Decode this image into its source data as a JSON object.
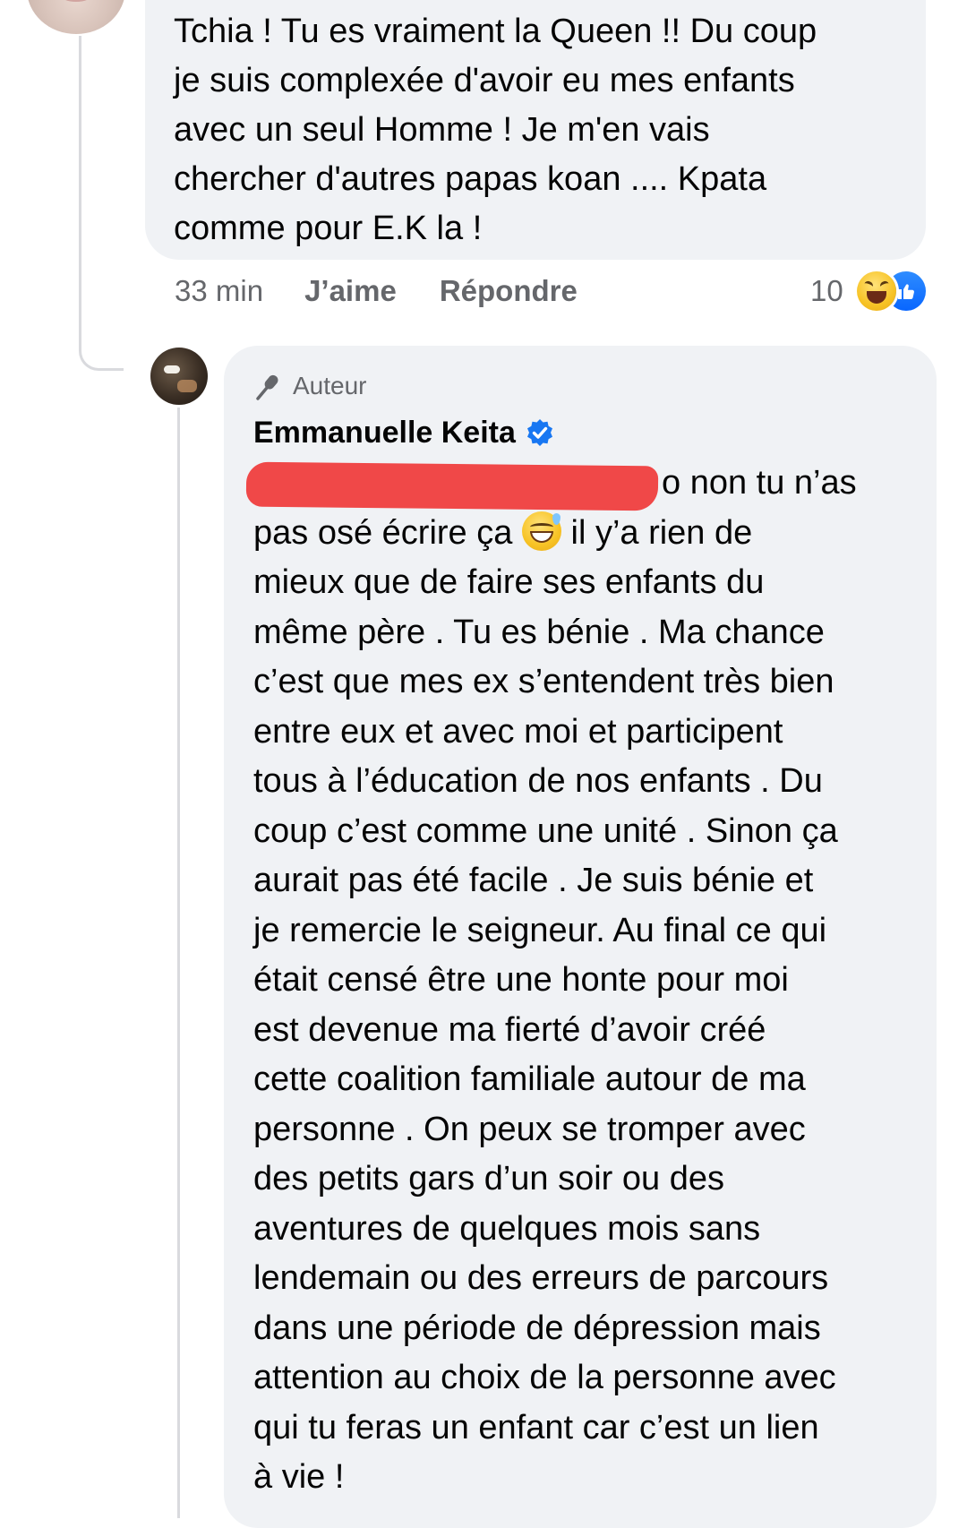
{
  "first_comment": {
    "text": "Tchia ! Tu es vraiment la Queen !! Du  coup\nje suis complexée d'avoir eu mes enfants\navec un seul Homme  ! Je m'en  vais\nchercher d'autres papas koan .... Kpata\ncomme pour E.K la !",
    "time": "33 min",
    "like_label": "J’aime",
    "reply_label": "Répondre",
    "reaction_count": "10",
    "reactions": [
      "haha-icon",
      "like-icon"
    ]
  },
  "reply": {
    "badge_label": "Auteur",
    "author_name": "Emmanuelle Keita",
    "verified": true,
    "text_lines": [
      "o  non tu n’as",
      "pas osé écrire ça",
      "il y’a rien de",
      "mieux que de faire ses enfants du\nmême père . Tu es bénie . Ma chance\nc’est que mes ex s’entendent très bien\nentre eux et avec moi et participent\ntous à l’éducation de nos enfants . Du\ncoup c’est comme une unité . Sinon ça\naurait pas été facile . Je suis bénie et\nje remercie le seigneur. Au final ce qui\nétait censé être une honte pour moi\nest devenue ma fierté d’avoir créé\ncette coalition familiale autour de ma\npersonne . On peux se tromper avec\ndes petits gars d’un soir ou des\naventures de quelques mois  sans\nlendemain  ou des erreurs de parcours\ndans une période de dépression mais\nattention au choix de la personne avec\nqui tu feras un enfant car c’est un lien\nà vie !"
    ]
  },
  "colors": {
    "bubble_bg": "#f0f2f5",
    "meta_text": "#65676b",
    "verified_blue": "#1877f2",
    "like_blue": "#0866ff",
    "redaction_red": "#f04848"
  }
}
